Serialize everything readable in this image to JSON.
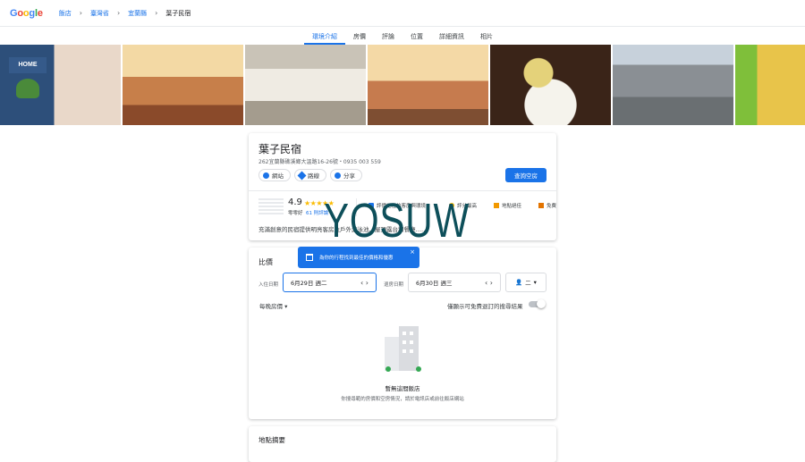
{
  "header": {
    "logo": [
      "G",
      "o",
      "o",
      "g",
      "l",
      "e"
    ],
    "breadcrumbs": [
      "飯店",
      "臺灣省",
      "宜蘭縣"
    ],
    "current": "葉子民宿"
  },
  "tabs": [
    {
      "label": "環境介紹",
      "active": true
    },
    {
      "label": "房價"
    },
    {
      "label": "評論"
    },
    {
      "label": "位置"
    },
    {
      "label": "詳細資訊"
    },
    {
      "label": "相片"
    }
  ],
  "photos": {
    "home_sign": "HOME"
  },
  "hotel": {
    "name": "葉子民宿",
    "address": "262宜蘭縣礁溪鄉大溫路16-26號・0935 003 559",
    "chips": [
      "網站",
      "路線",
      "分享"
    ],
    "check_button": "查詢空房",
    "rating": "4.9",
    "stars": "★★★★★",
    "rating_label": "零零好",
    "review_count": "61 則評論",
    "highlights": [
      "評價絕佳的客房與環境",
      "評分最高",
      "地點絕佳",
      "免費"
    ],
    "description": "充滿創意的民宿提供明亮客房及戶外游泳池、屋頂露台和餐廳……"
  },
  "watermark": "YOSUW",
  "pricing": {
    "title": "比價",
    "tooltip": "為你的行程找到最佳的價格和優惠",
    "tooltip_close": "×",
    "checkin_label": "入住日期",
    "checkin_value": "6月29日 週二",
    "checkout_label": "退房日期",
    "checkout_value": "6月30日 週三",
    "nav": "‹  ›",
    "guests": "二",
    "nightly": "每晚房價 ▾",
    "free_cancel": "僅顯示可免費退訂的搜尋結果",
    "no_result_title": "暫無這間飯店",
    "no_result_desc": "你搜尋範的房價和空房情況，請於電訊店或前往飯店網站"
  },
  "location": {
    "title": "地點摘要"
  },
  "colors": {
    "accent": "#1a73e8",
    "star": "#fbbc04",
    "watermark": "#0d4f5a"
  }
}
